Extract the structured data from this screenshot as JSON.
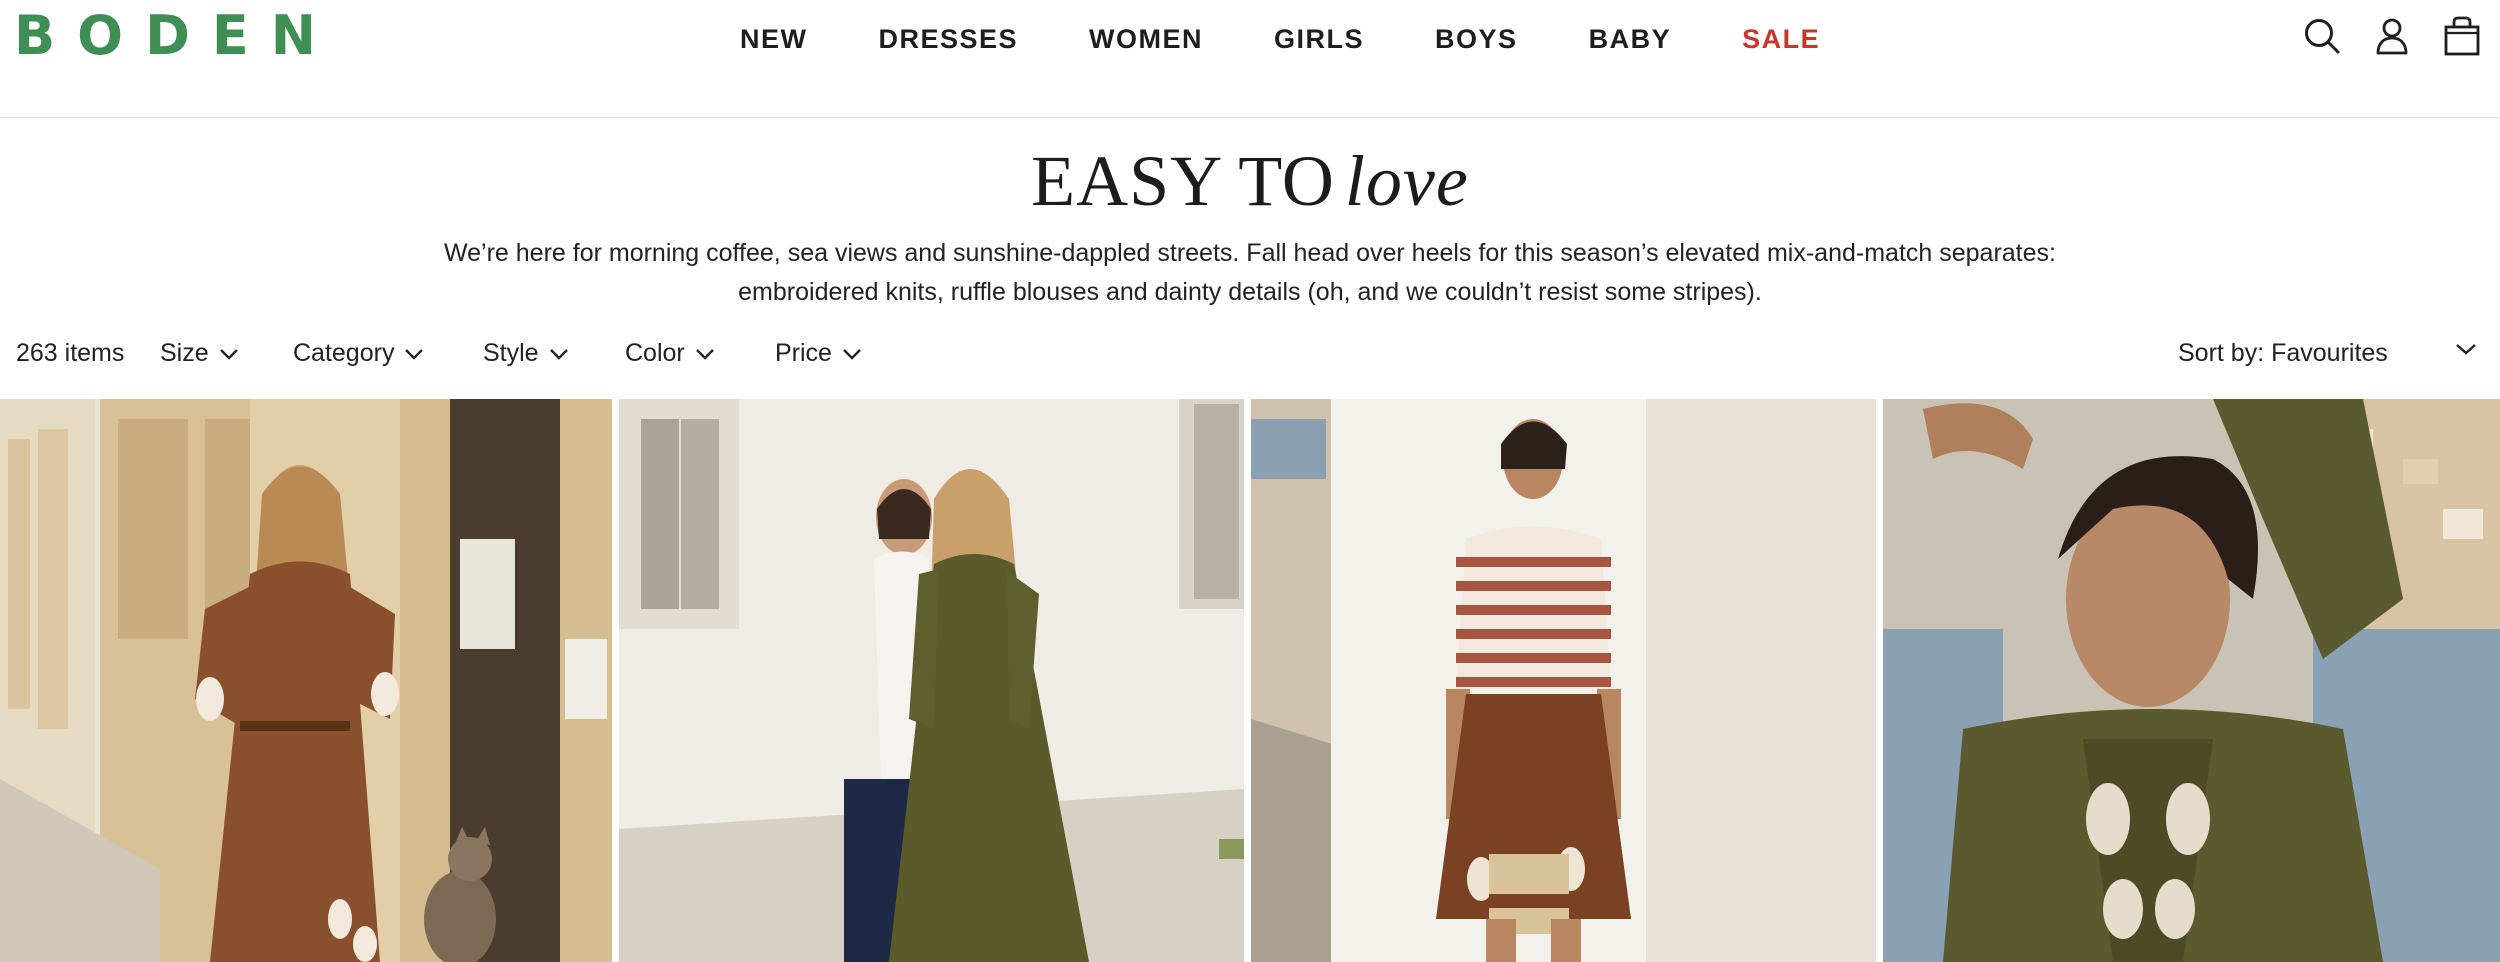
{
  "brand": {
    "logo_text": "BODEN",
    "logo_color": "#3f8f55"
  },
  "nav": {
    "items": [
      {
        "label": "NEW",
        "color": "#1e1e1e"
      },
      {
        "label": "DRESSES",
        "color": "#1e1e1e"
      },
      {
        "label": "WOMEN",
        "color": "#1e1e1e"
      },
      {
        "label": "GIRLS",
        "color": "#1e1e1e"
      },
      {
        "label": "BOYS",
        "color": "#1e1e1e"
      },
      {
        "label": "BABY",
        "color": "#1e1e1e"
      },
      {
        "label": "SALE",
        "color": "#c8352b"
      }
    ]
  },
  "header_icons": [
    "search-icon",
    "account-icon",
    "bag-icon"
  ],
  "hero": {
    "title_regular": "EASY TO",
    "title_italic": "love",
    "description": "We’re here for morning coffee, sea views and sunshine-dappled streets. Fall head over heels for this season’s elevated mix-and-match separates: embroidered knits, ruffle blouses and dainty details (oh, and we couldn’t resist some stripes)."
  },
  "filters": {
    "item_count": "263 items",
    "options": [
      "Size",
      "Category",
      "Style",
      "Color",
      "Price"
    ],
    "sort_label": "Sort by: Favourites"
  },
  "products": [
    {
      "image": "woman-in-brown-embroidered-maxi-dress-with-cat"
    },
    {
      "image": "two-women-walking-in-olive-dress-and-white-shirt"
    },
    {
      "image": "woman-in-striped-cardigan-and-brown-embroidered-skirt"
    },
    {
      "image": "woman-in-olive-embroidered-top-by-the-sea"
    }
  ]
}
